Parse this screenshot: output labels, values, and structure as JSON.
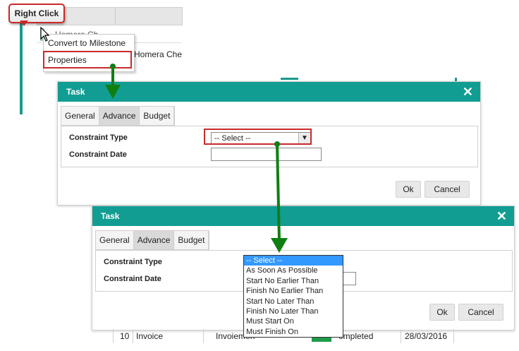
{
  "callout": {
    "label": "Right Click"
  },
  "background": {
    "row_text": "Homera Che",
    "row_text_partial": "Homera Ch"
  },
  "context_menu": {
    "items": [
      {
        "label": "Convert to Milestone"
      },
      {
        "label": "Properties"
      }
    ]
  },
  "dialog1": {
    "title": "Task",
    "close_symbol": "✕",
    "tabs": [
      {
        "label": "General"
      },
      {
        "label": "Advance"
      },
      {
        "label": "Budget"
      }
    ],
    "active_tab": "Advance",
    "fields": {
      "constraint_type_label": "Constraint Type",
      "constraint_type_value": "-- Select --",
      "constraint_date_label": "Constraint Date",
      "constraint_date_value": ""
    },
    "buttons": {
      "ok": "Ok",
      "cancel": "Cancel"
    }
  },
  "dialog2": {
    "title": "Task",
    "close_symbol": "✕",
    "tabs": [
      {
        "label": "General"
      },
      {
        "label": "Advance"
      },
      {
        "label": "Budget"
      }
    ],
    "active_tab": "Advance",
    "fields": {
      "constraint_type_label": "Constraint Type",
      "constraint_date_label": "Constraint Date"
    },
    "dropdown_options": [
      "-- Select --",
      "As Soon As Possible",
      "Start No Earlier Than",
      "Finish No Earlier Than",
      "Start No Later Than",
      "Finish No Later Than",
      "Must Start On",
      "Must Finish On"
    ],
    "selected_option": "-- Select --",
    "buttons": {
      "ok": "Ok",
      "cancel": "Cancel"
    }
  },
  "bottom_row": {
    "id": "10",
    "name": "Invoice",
    "type": "Invoiemen",
    "status": "ompleted",
    "date": "28/03/2016"
  },
  "colors": {
    "titlebar": "#119d92",
    "highlight_border": "#c92a2a",
    "arrow": "#0f7f12",
    "selected_option_bg": "#3399ff"
  },
  "icons": {
    "cursor": "arrow-cursor-icon",
    "close": "close-icon",
    "dropdown": "chevron-down-icon"
  }
}
